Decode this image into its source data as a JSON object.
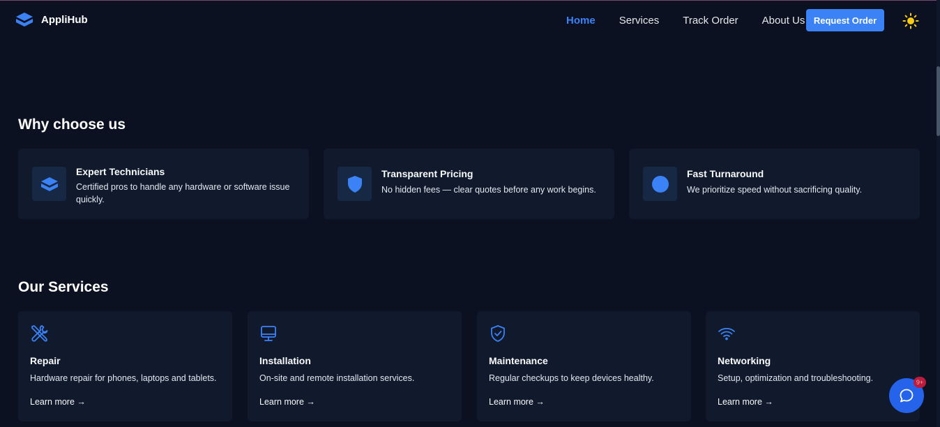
{
  "header": {
    "brand": "AppliHub",
    "logo_icon": "stack-box-icon",
    "nav": [
      {
        "label": "Home",
        "active": true
      },
      {
        "label": "Services",
        "active": false
      },
      {
        "label": "Track Order",
        "active": false
      },
      {
        "label": "About Us",
        "active": false
      }
    ],
    "cta_label": "Request Order",
    "theme_icon": "sun-icon"
  },
  "why": {
    "title": "Why choose us",
    "features": [
      {
        "icon": "stack-box-icon",
        "title": "Expert Technicians",
        "desc": "Certified pros to handle any hardware or software issue quickly."
      },
      {
        "icon": "shield-icon",
        "title": "Transparent Pricing",
        "desc": "No hidden fees — clear quotes before any work begins."
      },
      {
        "icon": "circle-icon",
        "title": "Fast Turnaround",
        "desc": "We prioritize speed without sacrificing quality."
      }
    ]
  },
  "services": {
    "title": "Our Services",
    "items": [
      {
        "icon": "tools-icon",
        "title": "Repair",
        "desc": "Hardware repair for phones, laptops and tablets.",
        "link": "Learn more →"
      },
      {
        "icon": "monitor-icon",
        "title": "Installation",
        "desc": "On-site and remote installation services.",
        "link": "Learn more →"
      },
      {
        "icon": "shield-check-icon",
        "title": "Maintenance",
        "desc": "Regular checkups to keep devices healthy.",
        "link": "Learn more →"
      },
      {
        "icon": "wifi-icon",
        "title": "Networking",
        "desc": "Setup, optimization and troubleshooting.",
        "link": "Learn more →"
      }
    ]
  },
  "chat": {
    "icon": "chat-bubble-icon",
    "badge": "9+"
  },
  "colors": {
    "background": "#0b1120",
    "card": "#111a2c",
    "accent": "#3b82f6",
    "sun": "#facc15"
  }
}
